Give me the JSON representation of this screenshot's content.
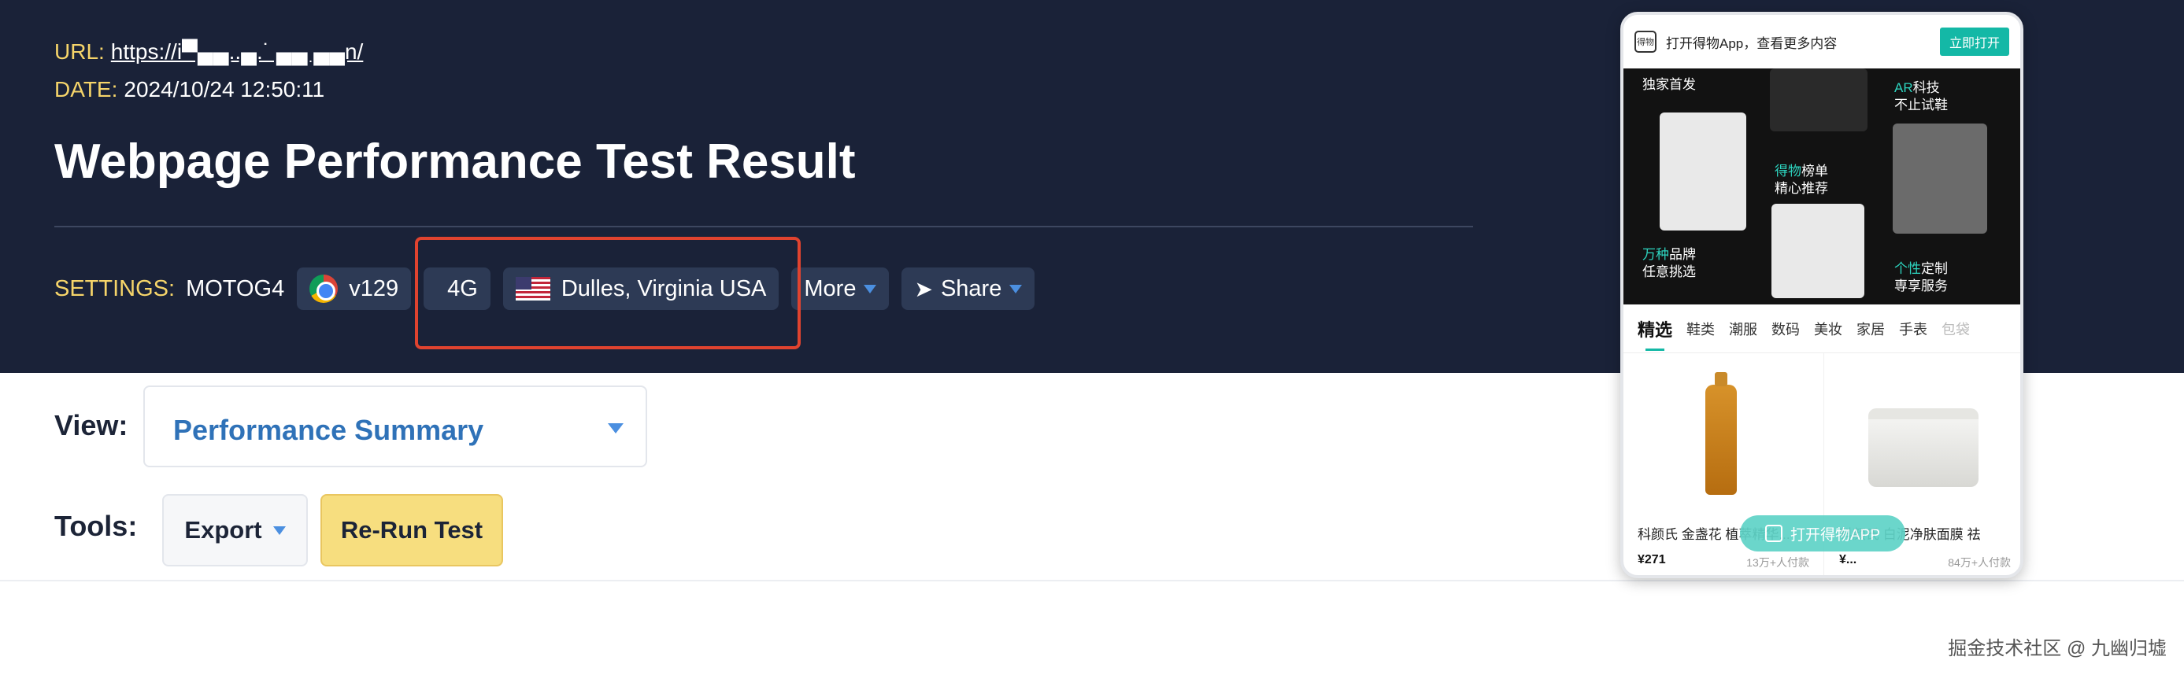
{
  "header": {
    "url_key": "URL:",
    "url_value": "https://i▀▄▄..▄.˙ ▄▄ ▄▄n/",
    "date_key": "DATE:",
    "date_value": "2024/10/24 12:50:11",
    "title": "Webpage Performance Test Result"
  },
  "settings": {
    "label": "SETTINGS:",
    "device": "MOTOG4",
    "browser_version": "v129",
    "network": "4G",
    "location": "Dulles, Virginia USA",
    "more_label": "More",
    "share_label": "Share",
    "share_icon": "paper-plane-icon",
    "browser_icon": "chrome-icon",
    "network_icon": "signal-bars-icon",
    "location_icon": "us-flag-icon"
  },
  "view": {
    "label": "View:",
    "selected": "Performance Summary"
  },
  "tools": {
    "label": "Tools:",
    "export_label": "Export",
    "rerun_label": "Re-Run Test"
  },
  "phone": {
    "app_logo": "得物",
    "app_bar_text": "打开得物App，查看更多内容",
    "app_open_button": "立即打开",
    "banner_texts": [
      {
        "hl": "",
        "rest": "独家首发"
      },
      {
        "hl": "AR",
        "rest": "科技"
      },
      {
        "hl": "",
        "rest": "不止试鞋"
      },
      {
        "hl": "得物",
        "rest": "榜单"
      },
      {
        "hl": "",
        "rest": "精心推荐"
      },
      {
        "hl": "万种",
        "rest": "品牌"
      },
      {
        "hl": "",
        "rest": "任意挑选"
      },
      {
        "hl": "个性",
        "rest": "定制"
      },
      {
        "hl": "",
        "rest": "専享服务"
      }
    ],
    "tabs": [
      "精选",
      "鞋类",
      "潮服",
      "数码",
      "美妆",
      "家居",
      "手表",
      "包袋"
    ],
    "products": [
      {
        "name": "科颜氏 金盏花 植萃精华...",
        "price": "¥271",
        "paid": "13万+人付款"
      },
      {
        "name": "科颜氏 白泥净肤面膜 祛",
        "price": "¥...",
        "paid": "84万+人付款"
      }
    ],
    "float_button": "打开得物APP"
  },
  "watermark": "掘金技术社区 @ 九幽归墟",
  "colors": {
    "header_bg": "#1a2238",
    "key_yellow": "#f6d56a",
    "pill_bg": "#2d3a55",
    "caret_blue": "#4b8fe0",
    "highlight_red": "#e0432f",
    "view_text_blue": "#2f72b8",
    "rerun_yellow": "#f7de7f",
    "teal": "#14b8a6"
  }
}
